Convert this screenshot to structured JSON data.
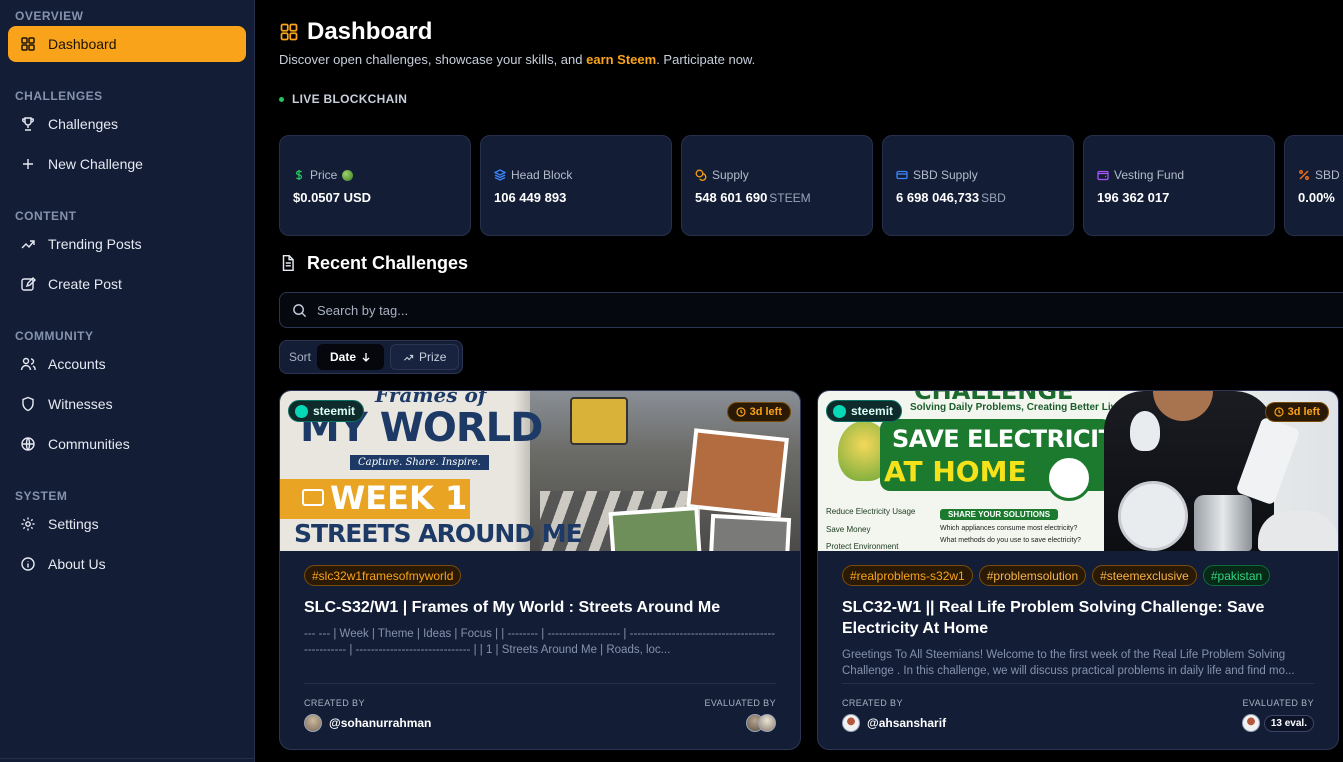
{
  "sidebar": {
    "sections": [
      {
        "title": "OVERVIEW",
        "items": [
          {
            "label": "Dashboard",
            "icon": "grid-icon",
            "active": true
          }
        ]
      },
      {
        "title": "CHALLENGES",
        "items": [
          {
            "label": "Challenges",
            "icon": "trophy-icon"
          },
          {
            "label": "New Challenge",
            "icon": "plus-icon"
          }
        ]
      },
      {
        "title": "CONTENT",
        "items": [
          {
            "label": "Trending Posts",
            "icon": "trending-icon"
          },
          {
            "label": "Create Post",
            "icon": "edit-icon"
          }
        ]
      },
      {
        "title": "COMMUNITY",
        "items": [
          {
            "label": "Accounts",
            "icon": "users-icon"
          },
          {
            "label": "Witnesses",
            "icon": "shield-icon"
          },
          {
            "label": "Communities",
            "icon": "globe-icon"
          }
        ]
      },
      {
        "title": "SYSTEM",
        "items": [
          {
            "label": "Settings",
            "icon": "gear-icon"
          },
          {
            "label": "About Us",
            "icon": "info-icon"
          }
        ]
      }
    ]
  },
  "header": {
    "title": "Dashboard",
    "subtitle_before": "Discover open challenges, showcase your skills, and ",
    "subtitle_highlight": "earn Steem",
    "subtitle_after": ". Participate now.",
    "live_label": "LIVE BLOCKCHAIN"
  },
  "stats": [
    {
      "label": "Price",
      "value": "$0.0507 USD",
      "unit": "",
      "icon": "dollar-icon",
      "color": "#22c55e"
    },
    {
      "label": "Head Block",
      "value": "106 449 893",
      "unit": "",
      "icon": "layers-icon",
      "color": "#3b82f6"
    },
    {
      "label": "Supply",
      "value": "548 601 690",
      "unit": "STEEM",
      "icon": "coins-icon",
      "color": "#f59e0b"
    },
    {
      "label": "SBD Supply",
      "value": "6 698 046,733",
      "unit": "SBD",
      "icon": "card-icon",
      "color": "#3b82f6"
    },
    {
      "label": "Vesting Fund",
      "value": "196 362 017",
      "unit": "",
      "icon": "wallet-icon",
      "color": "#a855f7"
    },
    {
      "label": "SBD R",
      "value": "0.00%",
      "unit": "",
      "icon": "percent-icon",
      "color": "#f97316"
    }
  ],
  "recent": {
    "title": "Recent Challenges",
    "search_placeholder": "Search by tag...",
    "sort_label": "Sort",
    "sort_date": "Date",
    "sort_prize": "Prize"
  },
  "cards": [
    {
      "steemit": "steemit",
      "time_left": "3d left",
      "image_text": [
        "Frames of",
        "MY WORLD",
        "Capture. Share. Inspire.",
        "WEEK 1",
        "STREETS AROUND ME"
      ],
      "tags": [
        "#slc32w1framesofmyworld"
      ],
      "title": "SLC-S32/W1 | Frames of My World : Streets Around Me",
      "desc": "--- --- | Week | Theme | Ideas | Focus | | -------- | ------------------- | ------------------------------------------------- | ------------------------------ | | 1 | Streets Around Me | Roads, loc...",
      "created_by_label": "CREATED BY",
      "author": "@sohanurrahman",
      "evaluated_by_label": "EVALUATED BY",
      "eval_count": ""
    },
    {
      "steemit": "steemit",
      "time_left": "3d left",
      "image_text": [
        "CHALLENGE",
        "Solving Daily Problems, Creating Better Lives",
        "SAVE ELECTRICITY",
        "AT HOME",
        "Reduce Electricity Usage",
        "Save Money",
        "Protect Environment",
        "SHARE YOUR SOLUTIONS",
        "Which appliances consume most electricity?",
        "What methods do you use to save electricity?"
      ],
      "tags": [
        "#realproblems-s32w1",
        "#problemsolution",
        "#steemexclusive",
        "#pakistan"
      ],
      "title": "SLC32-W1 || Real Life Problem Solving Challenge: Save Electricity At Home",
      "desc": "Greetings To All Steemians! Welcome to the first week of the Real Life Problem Solving Challenge . In this challenge, we will discuss practical problems in daily life and find mo...",
      "created_by_label": "CREATED BY",
      "author": "@ahsansharif",
      "evaluated_by_label": "EVALUATED BY",
      "eval_count": "13 eval."
    }
  ]
}
